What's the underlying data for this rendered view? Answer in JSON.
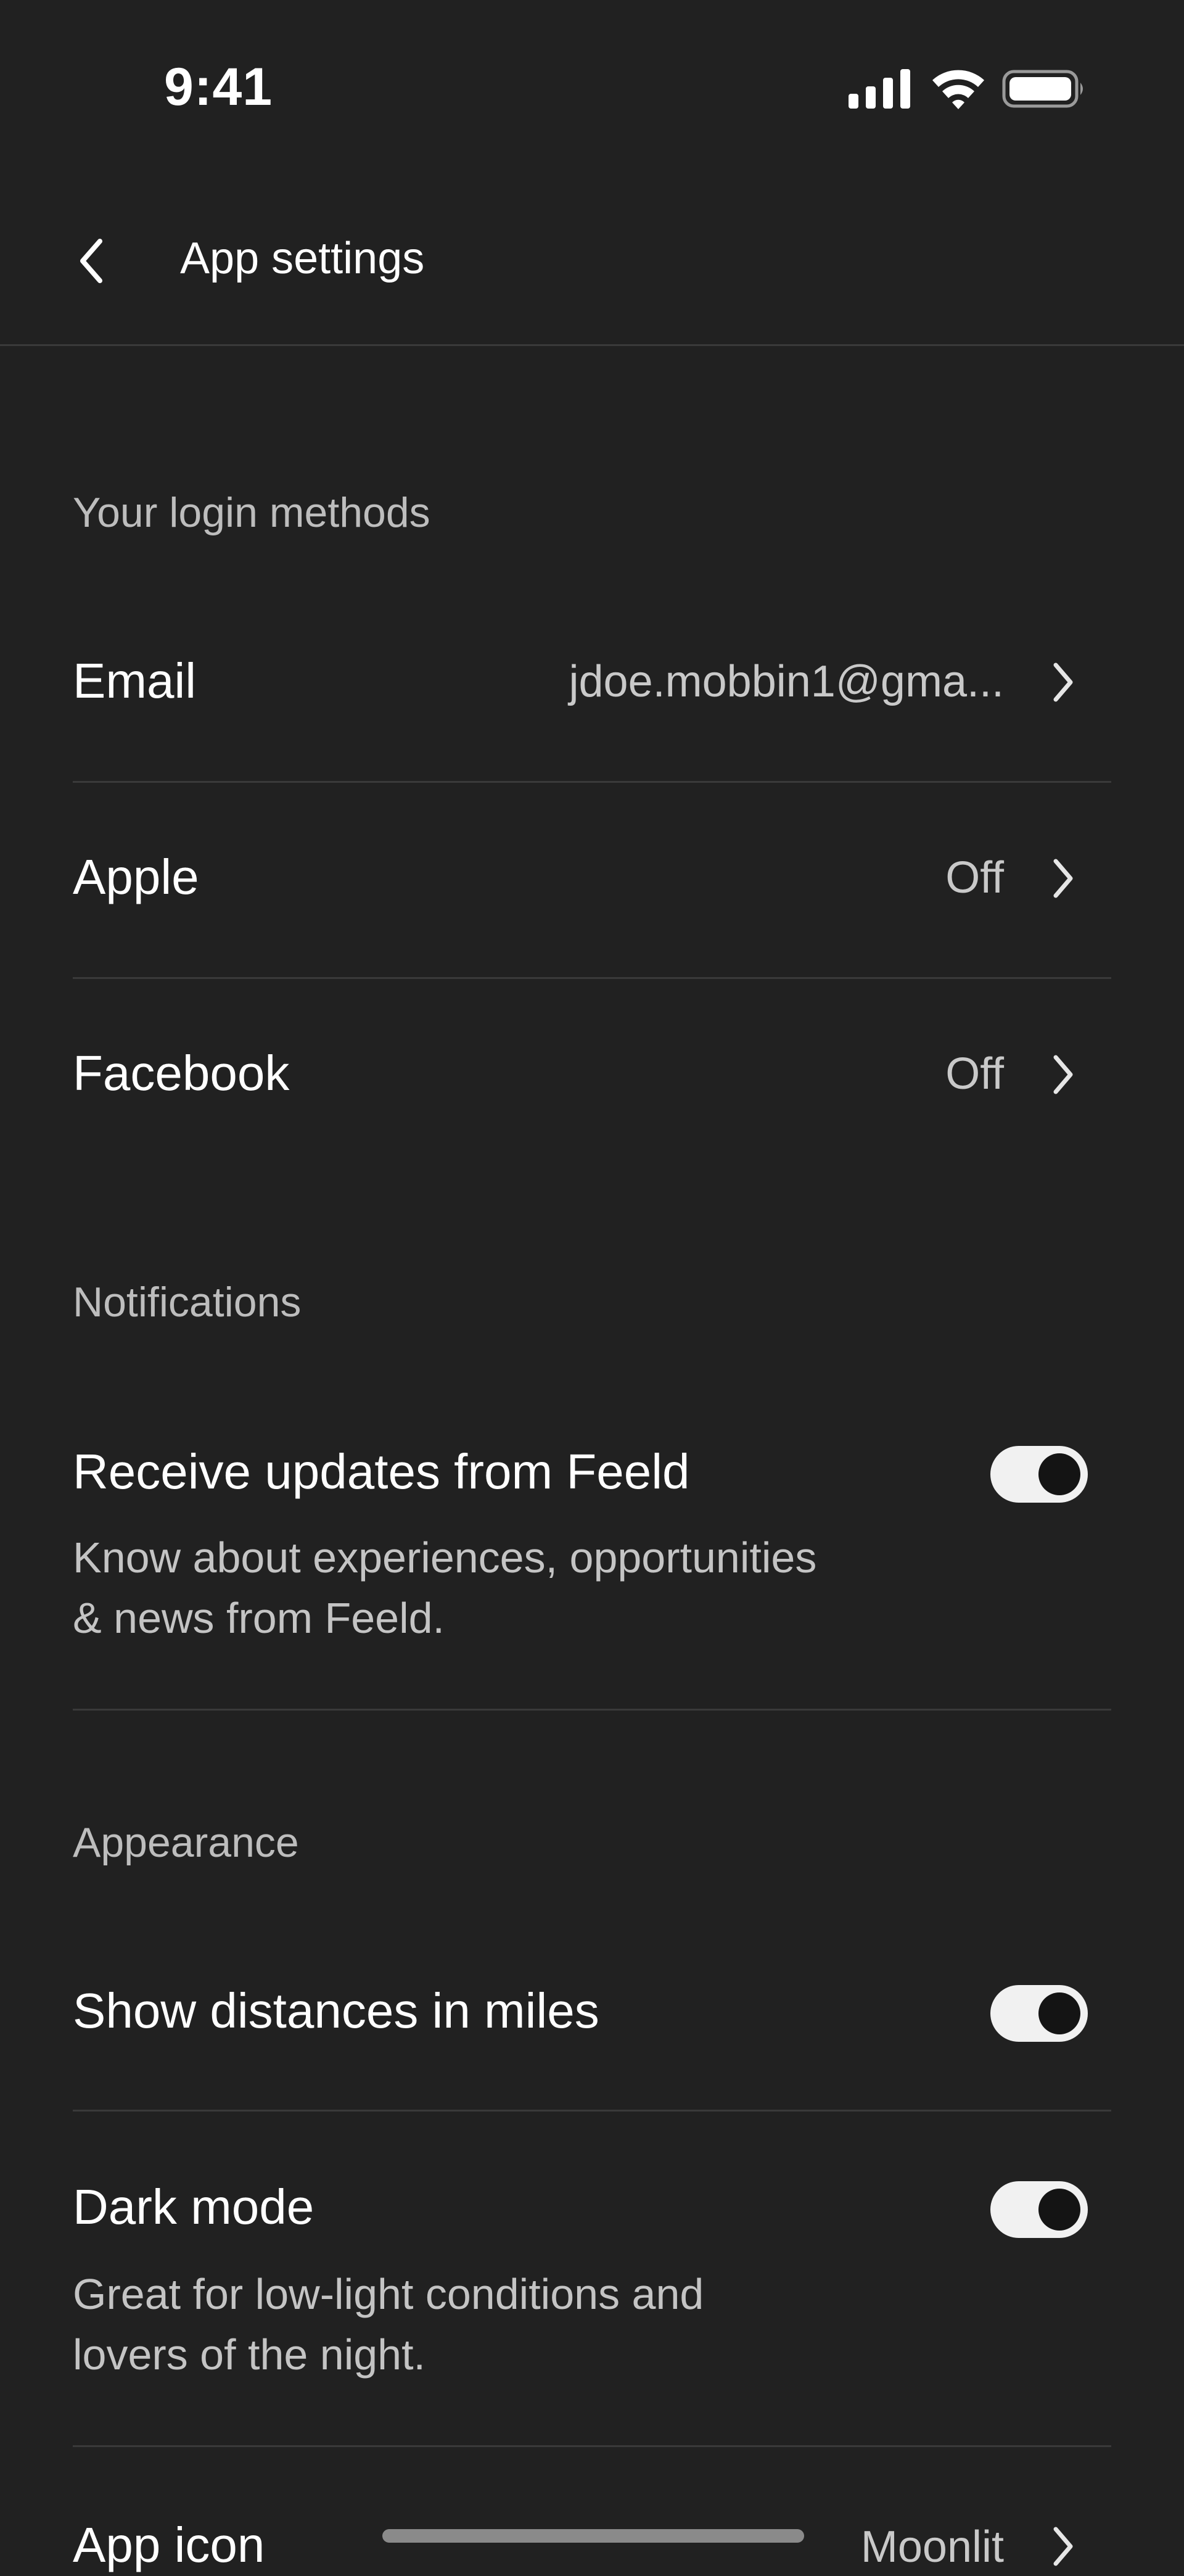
{
  "status_bar": {
    "time": "9:41",
    "icons": [
      "signal-icon",
      "wifi-icon",
      "battery-icon"
    ]
  },
  "header": {
    "back_icon": "chevron-left-icon",
    "title": "App settings"
  },
  "login_methods": {
    "section_label": "Your login methods",
    "rows": [
      {
        "label": "Email",
        "value": "jdoe.mobbin1@gma..."
      },
      {
        "label": "Apple",
        "value": "Off"
      },
      {
        "label": "Facebook",
        "value": "Off"
      }
    ]
  },
  "notifications": {
    "section_label": "Notifications",
    "updates": {
      "label": "Receive updates from Feeld",
      "description_line1": "Know about experiences, opportunities",
      "description_line2": "& news from Feeld.",
      "enabled": true
    }
  },
  "appearance": {
    "section_label": "Appearance",
    "distances": {
      "label": "Show distances in miles",
      "enabled": true
    },
    "dark_mode": {
      "label": "Dark mode",
      "description_line1": "Great for low-light conditions and",
      "description_line2": "lovers of the night.",
      "enabled": true
    },
    "app_icon": {
      "label": "App icon",
      "value": "Moonlit"
    }
  },
  "colors": {
    "background": "#212121",
    "text_primary": "#ffffff",
    "text_secondary": "#c4c4c4",
    "divider": "#3a3a3a",
    "toggle_on_track": "#f1f1f1",
    "toggle_knob": "#141414"
  }
}
